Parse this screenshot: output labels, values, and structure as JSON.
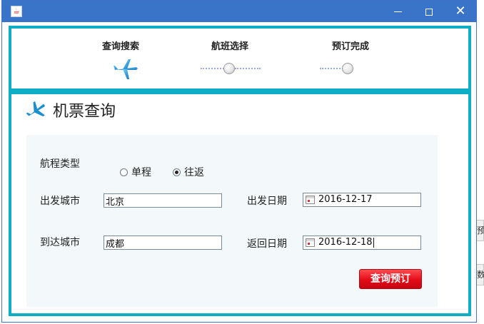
{
  "window": {
    "icon": "java-cup-icon",
    "controls": [
      "minimize-icon",
      "maximize-icon",
      "close-icon"
    ],
    "close_glyph": "✕"
  },
  "steps": [
    {
      "label": "查询搜索",
      "state": "active"
    },
    {
      "label": "航班选择",
      "state": "pending"
    },
    {
      "label": "预订完成",
      "state": "pending"
    }
  ],
  "header": {
    "title": "机票查询",
    "icon": "airplane-icon"
  },
  "form": {
    "trip_type_label": "航程类型",
    "trip_options": [
      {
        "label": "单程",
        "checked": false
      },
      {
        "label": "往返",
        "checked": true
      }
    ],
    "depart_city_label": "出发城市",
    "depart_city_value": "北京",
    "arrive_city_label": "到达城市",
    "arrive_city_value": "成都",
    "depart_date_label": "出发日期",
    "depart_date_value": "2016-12-17",
    "return_date_label": "返回日期",
    "return_date_value": "2016-12-18",
    "submit_label": "查询预订"
  },
  "background": {
    "glyph_1": "预",
    "glyph_2": "数"
  },
  "colors": {
    "titlebar": "#3a74c9",
    "panel_border": "#10aec2",
    "button": "#e40a18",
    "plane": "#1a8fd0"
  }
}
